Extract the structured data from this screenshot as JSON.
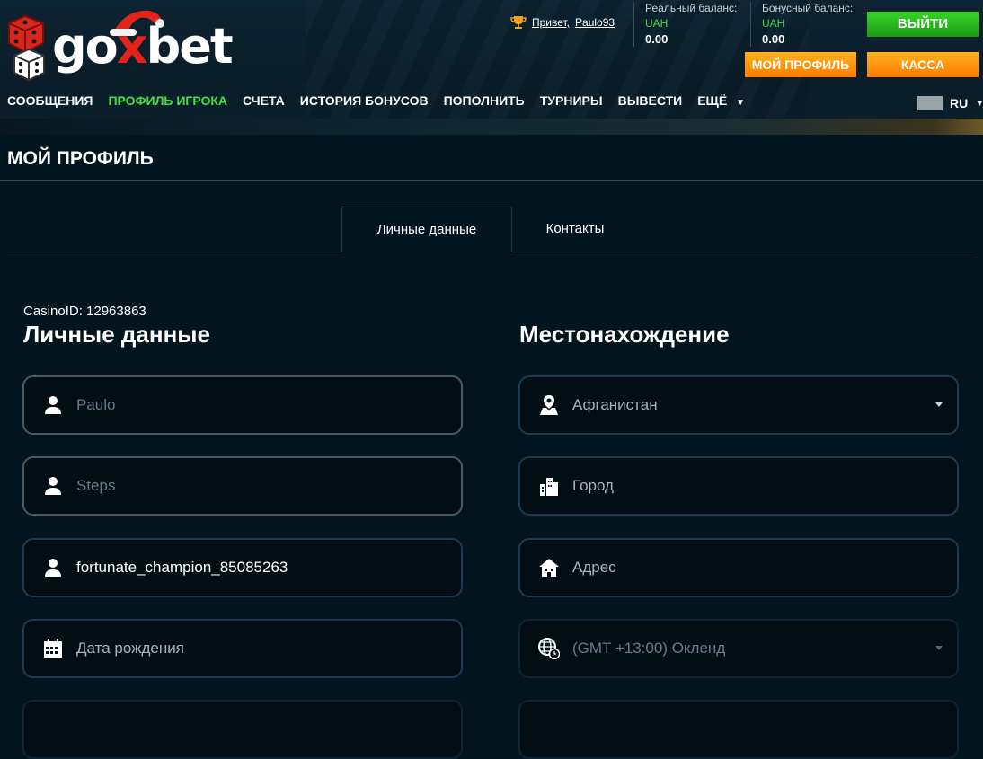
{
  "logo": {
    "text_go": "go",
    "text_x": "x",
    "text_bet": "bet"
  },
  "header": {
    "greeting": "Привет,",
    "username": "Paulo93",
    "real_balance": {
      "label": "Реальный баланс:",
      "currency": "UAH",
      "value": "0.00"
    },
    "bonus_balance": {
      "label": "Бонусный баланс:",
      "currency": "UAH",
      "value": "0.00"
    },
    "exit_label": "ВЫЙТИ",
    "profile_label": "МОЙ ПРОФИЛЬ",
    "cash_label": "КАССА"
  },
  "nav": {
    "items": [
      {
        "label": "СООБЩЕНИЯ"
      },
      {
        "label": "ПРОФИЛЬ ИГРОКА"
      },
      {
        "label": "СЧЕТА"
      },
      {
        "label": "ИСТОРИЯ БОНУСОВ"
      },
      {
        "label": "ПОПОЛНИТЬ"
      },
      {
        "label": "ТУРНИРЫ"
      },
      {
        "label": "ВЫВЕСТИ"
      },
      {
        "label": "ЕЩЁ"
      }
    ],
    "active_index": 1,
    "lang": "RU"
  },
  "page": {
    "title": "МОЙ ПРОФИЛЬ",
    "tabs": [
      {
        "label": "Личные данные"
      },
      {
        "label": "Контакты"
      }
    ],
    "casino_id": "CasinoID: 12963863"
  },
  "personal": {
    "title": "Личные данные",
    "first_name_placeholder": "Paulo",
    "last_name_placeholder": "Steps",
    "nickname_value": "fortunate_champion_85085263",
    "birthdate_placeholder": "Дата рождения"
  },
  "location": {
    "title": "Местонахождение",
    "country": "Афганистан",
    "city_placeholder": "Город",
    "address_placeholder": "Адрес",
    "timezone": "(GMT +13:00) Окленд"
  },
  "colors": {
    "accent_green": "#3ce63c",
    "button_orange": "#ff8c00",
    "field_border": "#1c3a52"
  }
}
